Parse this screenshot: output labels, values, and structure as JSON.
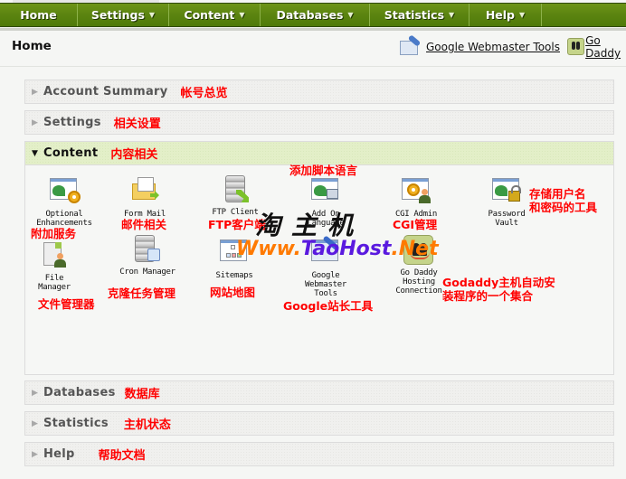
{
  "nav": {
    "items": [
      {
        "label": "Home",
        "has_dropdown": false
      },
      {
        "label": "Settings",
        "has_dropdown": true
      },
      {
        "label": "Content",
        "has_dropdown": true
      },
      {
        "label": "Databases",
        "has_dropdown": true
      },
      {
        "label": "Statistics",
        "has_dropdown": true
      },
      {
        "label": "Help",
        "has_dropdown": true
      }
    ],
    "caret": "▼"
  },
  "header": {
    "title": "Home",
    "links": [
      {
        "label": "Google Webmaster Tools",
        "icon": "google-webmaster-icon"
      },
      {
        "label": "Go Daddy",
        "icon": "go-daddy-hosting-connection-icon"
      }
    ]
  },
  "panels": [
    {
      "title": "Account Summary",
      "note": "帐号总览",
      "expanded": false
    },
    {
      "title": "Settings",
      "note": "相关设置",
      "expanded": false
    },
    {
      "title": "Content",
      "note": "内容相关",
      "expanded": true
    },
    {
      "title": "Databases",
      "note": "数据库",
      "expanded": false
    },
    {
      "title": "Statistics",
      "note": "主机状态",
      "expanded": false
    },
    {
      "title": "Help",
      "note": "帮助文档",
      "expanded": false
    }
  ],
  "arrows": {
    "collapsed": "▶",
    "expanded": "▼"
  },
  "content_tools": [
    {
      "label_lines": [
        "Optional",
        "Enhancements"
      ],
      "note": "附加服务",
      "icon": "optional-enhancements-icon"
    },
    {
      "label_lines": [
        "Form Mail"
      ],
      "note": "邮件相关",
      "icon": "form-mail-icon"
    },
    {
      "label_lines": [
        "FTP Client"
      ],
      "note": "FTP客户端",
      "icon": "ftp-client-icon"
    },
    {
      "label_lines": [
        "Add On",
        "Language"
      ],
      "note": "添加脚本语言",
      "icon": "add-on-language-icon"
    },
    {
      "label_lines": [
        "CGI Admin"
      ],
      "note": "CGI管理",
      "icon": "cgi-admin-icon"
    },
    {
      "label_lines": [
        "Password",
        "Vault"
      ],
      "note_lines": [
        "存储用户名",
        "和密码的工具"
      ],
      "icon": "password-vault-icon"
    },
    {
      "label_lines": [
        "File",
        "Manager"
      ],
      "note": "文件管理器",
      "icon": "file-manager-icon"
    },
    {
      "label_lines": [
        "Cron Manager"
      ],
      "note": "克隆任务管理",
      "icon": "cron-manager-icon"
    },
    {
      "label_lines": [
        "Sitemaps"
      ],
      "note": "网站地图",
      "icon": "sitemaps-icon"
    },
    {
      "label_lines": [
        "Google",
        "Webmaster",
        "Tools"
      ],
      "note": "Google站长工具",
      "icon": "google-webmaster-tools-icon"
    },
    {
      "label_lines": [
        "Go Daddy",
        "Hosting",
        "Connection"
      ],
      "note_lines": [
        "Godaddy主机自动安",
        "装程序的一个集合"
      ],
      "icon": "go-daddy-hosting-connection-icon"
    }
  ],
  "watermark": {
    "cn": "淘主机",
    "url_parts": [
      "Www.",
      "TaoHost",
      ".Net"
    ]
  }
}
